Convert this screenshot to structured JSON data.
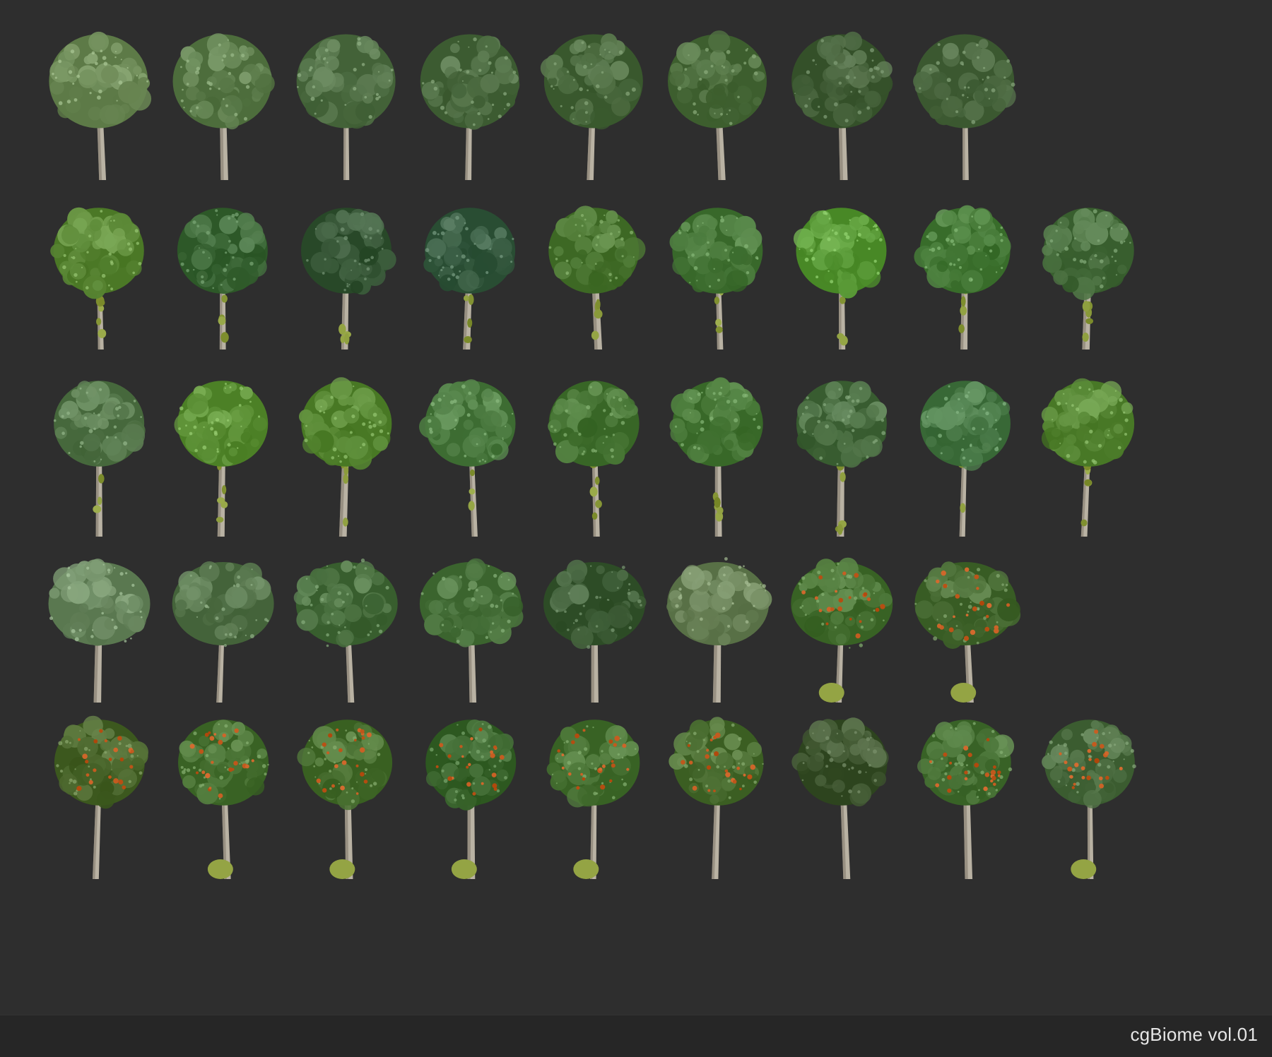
{
  "caption": "cgBiome vol.01",
  "colors": {
    "background": "#2e2e2e",
    "footer_background": "#262626",
    "caption_text": "#e6e6e6",
    "trunk": "#b9b2a3",
    "trunk_shadow": "#7d7568",
    "ivy": "#8a9a3a",
    "berries": "#c25a1e"
  },
  "rows": [
    {
      "name": "row-1",
      "variant": "broad-crown",
      "foliage": [
        "#6f8c59",
        "#5f7f4e",
        "#55744a",
        "#4e6d43",
        "#4b6a3f",
        "#4f7040",
        "#46623b",
        "#4d6a42"
      ]
    },
    {
      "name": "row-2",
      "variant": "ivy-trunk",
      "foliage": [
        "#5d8a38",
        "#3f6a3a",
        "#3a5a3a",
        "#3b5f45",
        "#4f7a36",
        "#4a7a3c",
        "#5a9a38",
        "#4a7e3c",
        "#4a7040"
      ]
    },
    {
      "name": "row-3",
      "variant": "ivy-trunk",
      "foliage": [
        "#587a4e",
        "#5e9238",
        "#5a8a36",
        "#4f7e44",
        "#4a7838",
        "#4a7a3a",
        "#4a6e42",
        "#4a7a48",
        "#5a8a38"
      ]
    },
    {
      "name": "row-4",
      "variant": "dome-crown",
      "foliage": [
        "#6c8a62",
        "#56754c",
        "#4a7040",
        "#4d7640",
        "#3f5e38",
        "#6a8258",
        "#4a7436",
        "#4a6e36"
      ],
      "berry_trees": [
        6,
        7
      ]
    },
    {
      "name": "row-5",
      "variant": "berry-tree",
      "foliage": [
        "#4e6a30",
        "#4b7436",
        "#4b7233",
        "#3f6a32",
        "#4a7436",
        "#4d7034",
        "#3f5630",
        "#4a7438",
        "#4d6e42"
      ],
      "berry_trees": [
        0,
        1,
        2,
        3,
        4,
        5,
        7,
        8
      ]
    }
  ]
}
